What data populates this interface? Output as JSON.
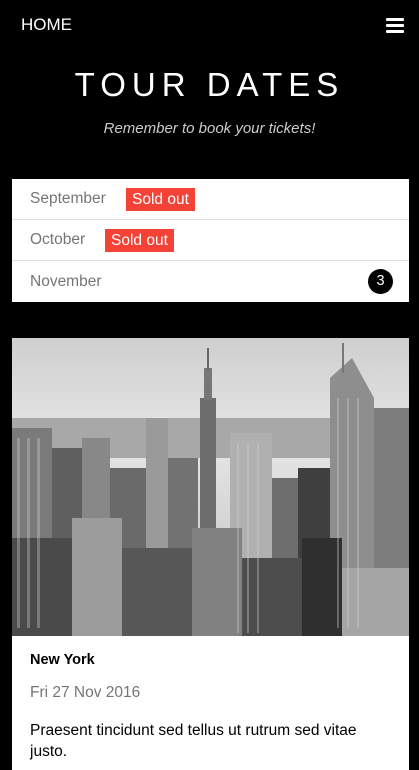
{
  "nav": {
    "home_label": "HOME",
    "menu_icon": "hamburger-menu-icon"
  },
  "header": {
    "title": "TOUR DATES",
    "subtitle": "Remember to book your tickets!"
  },
  "months": [
    {
      "name": "September",
      "badge": "Sold out"
    },
    {
      "name": "October",
      "badge": "Sold out"
    },
    {
      "name": "November",
      "count": "3"
    }
  ],
  "colors": {
    "sold_out": "#f44336",
    "badge": "#000000"
  },
  "card": {
    "image": "city skyline (black and white)",
    "city": "New York",
    "date": "Fri 27 Nov 2016",
    "description": "Praesent tincidunt sed tellus ut rutrum sed vitae justo."
  }
}
